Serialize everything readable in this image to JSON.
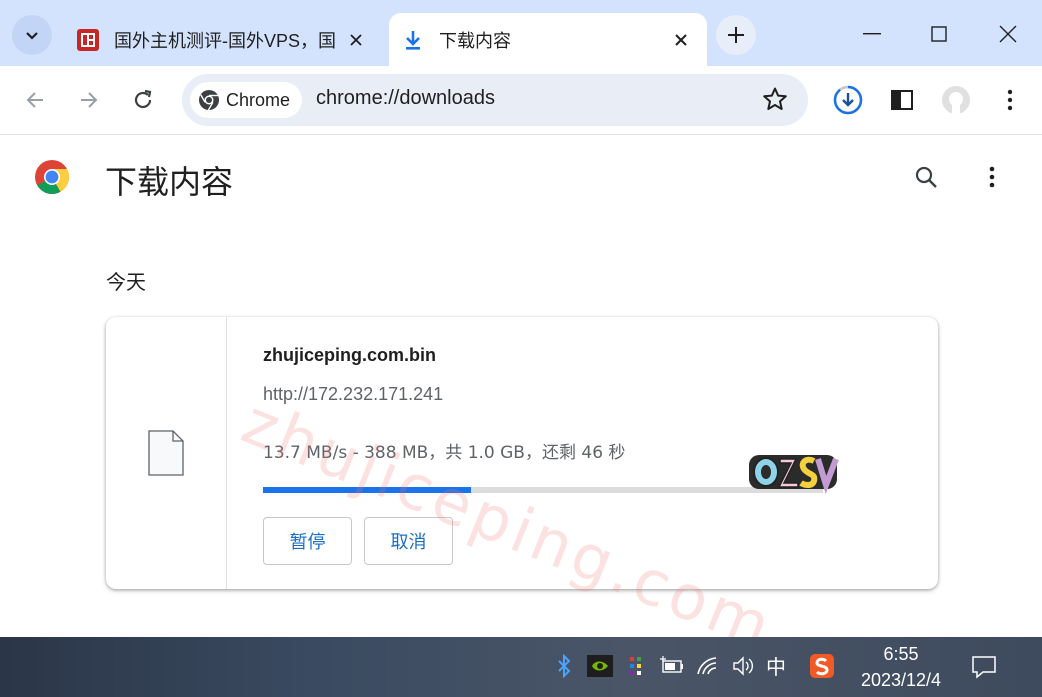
{
  "tabs": [
    {
      "title": "国外主机测评-国外VPS，国",
      "active": false
    },
    {
      "title": "下载内容",
      "active": true
    }
  ],
  "omnibox": {
    "chip_label": "Chrome",
    "url": "chrome://downloads"
  },
  "page": {
    "title": "下载内容",
    "date_header": "今天"
  },
  "download": {
    "filename": "zhujiceping.com.bin",
    "source": "http://172.232.171.241",
    "status": "13.7 MB/s - 388 MB，共 1.0 GB，还剩 46 秒",
    "progress_fraction": 0.372,
    "pause_label": "暂停",
    "cancel_label": "取消"
  },
  "watermark": {
    "text": "zhujiceping.com"
  },
  "taskbar": {
    "ime_label": "中",
    "time": "6:55",
    "date": "2023/12/4"
  },
  "colors": {
    "tabstrip": "#d3e3fd",
    "accent": "#1a73e8",
    "button_text": "#1a6fc4"
  },
  "icons": [
    "tab-search-icon",
    "tab-favicon-icon",
    "download-tab-icon",
    "close-icon",
    "new-tab-icon",
    "minimize-icon",
    "maximize-icon",
    "window-close-icon",
    "back-icon",
    "forward-icon",
    "reload-icon",
    "chrome-chip-icon",
    "bookmark-star-icon",
    "downloads-toolbar-icon",
    "side-panel-icon",
    "profile-avatar-icon",
    "menu-dots-icon",
    "chrome-logo-icon",
    "search-icon",
    "file-icon",
    "bluetooth-icon",
    "nvidia-icon",
    "color-tray-icon",
    "battery-icon",
    "wifi-icon",
    "volume-icon",
    "sogou-icon",
    "notification-icon"
  ]
}
